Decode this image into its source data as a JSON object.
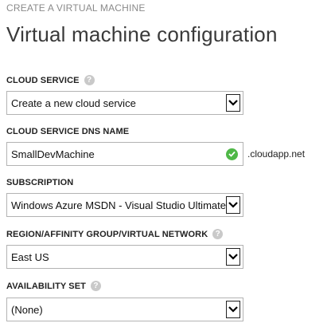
{
  "header": {
    "eyebrow": "CREATE A VIRTUAL MACHINE",
    "title": "Virtual machine configuration"
  },
  "fields": {
    "cloud_service": {
      "label": "CLOUD SERVICE",
      "value": "Create a new cloud service",
      "help_icon": "question-mark-icon"
    },
    "dns_name": {
      "label": "CLOUD SERVICE DNS NAME",
      "value": "SmallDevMachine",
      "suffix": ".cloudapp.net",
      "status_icon": "checkmark-icon",
      "status_color": "#4fb847"
    },
    "subscription": {
      "label": "SUBSCRIPTION",
      "value": "Windows Azure MSDN - Visual Studio Ultimate"
    },
    "region": {
      "label": "REGION/AFFINITY GROUP/VIRTUAL NETWORK",
      "value": "East US",
      "help_icon": "question-mark-icon"
    },
    "availability_set": {
      "label": "AVAILABILITY SET",
      "value": "(None)",
      "help_icon": "question-mark-icon"
    }
  },
  "icons": {
    "help_glyph": "?",
    "dropdown": "chevron-down-icon"
  }
}
